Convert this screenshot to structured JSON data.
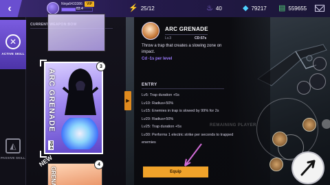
{
  "header": {
    "back_icon": "chevron-left-icon",
    "player_name": "Ninja6433386",
    "vip_label": "VIP",
    "level_text": "83.4",
    "level_progress": 0.45,
    "stats": {
      "energy": "25/12",
      "flame": "40",
      "diamonds": "79217",
      "cash": "559655"
    },
    "mail_icon": "mail-icon"
  },
  "sidebar": {
    "items": [
      {
        "label": "ACTIVE SKILL",
        "icon": "crossed-swords-icon",
        "active": true
      },
      {
        "label": "PASSIVE SKILL",
        "icon": "wolf-icon",
        "active": false
      }
    ]
  },
  "weapon_panel": {
    "header": "CURRENT WEAPON:BOW",
    "cards": {
      "main_title": "ARC GRENADE",
      "main_code": "HD-6",
      "badge_main": "3",
      "badge_next": "4",
      "new_tag": "NEW",
      "bottom_title": "GRENADE"
    }
  },
  "skill": {
    "name": "ARC GRENADE",
    "level": "Lv.3",
    "cd": "CD:57s",
    "description": "Throw a trap that creates a slowing zone on impact.",
    "cd_note": "Cd -1s per level"
  },
  "entry": {
    "title": "ENTRY",
    "lines": [
      "Lv5:  Trap duration +5s",
      "Lv10:  Radius+50%",
      "Lv15:  Enemies in trap is slowed by 99% for 2s",
      "Lv20:  Radius+50%",
      "Lv25:  Trap duration +5s",
      "Lv30:  Performs 1 electric strike per seconds to trapped enemies"
    ]
  },
  "equip_label": "Equip",
  "hud": {
    "remaining_label": "REMAINING PLAYER"
  },
  "colors": {
    "accent": "#7b5ce0",
    "equip": "#f0a32a",
    "cd_note": "#9d7cff"
  }
}
